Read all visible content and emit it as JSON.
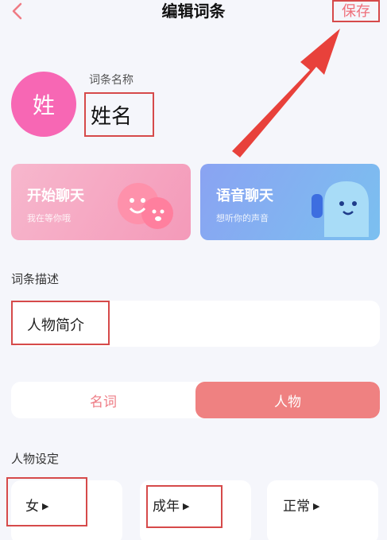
{
  "header": {
    "back_icon": "chevron-left-icon",
    "title": "编辑词条",
    "save_label": "保存"
  },
  "entry": {
    "avatar_char": "姓",
    "name_label": "词条名称",
    "name_value": "姓名"
  },
  "cards": [
    {
      "title": "开始聊天",
      "subtitle": "我在等你哦",
      "icon": "chat-faces-illustration"
    },
    {
      "title": "语音聊天",
      "subtitle": "想听你的声音",
      "icon": "voice-ghost-illustration"
    }
  ],
  "description": {
    "label": "词条描述",
    "value": "人物简介"
  },
  "type_toggle": {
    "options": [
      "名词",
      "人物"
    ],
    "selected": "人物"
  },
  "character_settings": {
    "label": "人物设定",
    "items": [
      "女",
      "成年",
      "正常"
    ]
  },
  "colors": {
    "accent_pink": "#ef8181",
    "avatar_pink": "#f767b4",
    "annotation_red": "#d64a4a"
  }
}
